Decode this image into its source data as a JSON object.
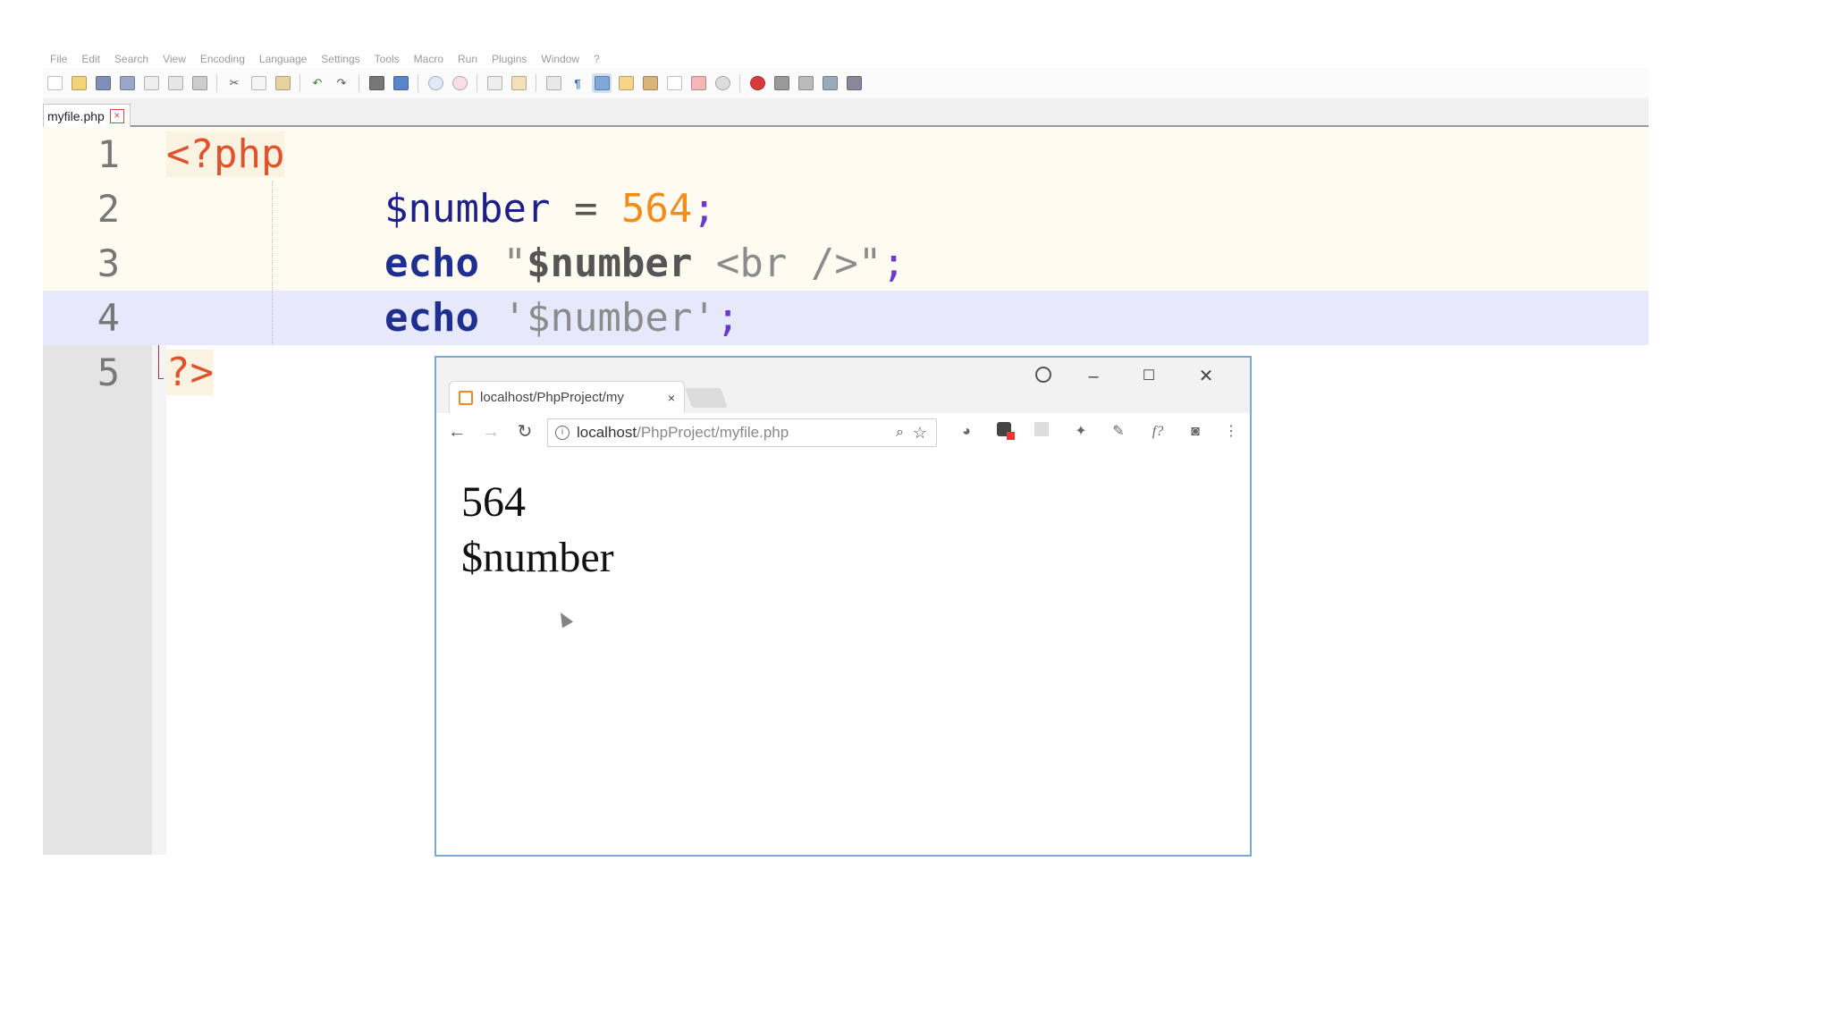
{
  "editor": {
    "menu_items": [
      "File",
      "Edit",
      "Search",
      "View",
      "Encoding",
      "Language",
      "Settings",
      "Tools",
      "Macro",
      "Run",
      "Plugins",
      "Window",
      "?"
    ],
    "tab": {
      "label": "myfile.php",
      "close": "×"
    },
    "lines": [
      {
        "number": "1",
        "php_open": "<?php"
      },
      {
        "number": "2",
        "var": "$number",
        "op": "=",
        "value": "564",
        "semi": ";"
      },
      {
        "number": "3",
        "keyword": "echo",
        "str_open": "\"",
        "str_var": "$number",
        "str_rest": " <br />\"",
        "semi": ";"
      },
      {
        "number": "4",
        "keyword": "echo",
        "str": "'$number'",
        "semi": ";"
      },
      {
        "number": "5",
        "php_close": "?>"
      }
    ]
  },
  "browser": {
    "tab_title": "localhost/PhpProject/my",
    "tab_close": "×",
    "window_controls": {
      "minimize": "–",
      "maximize": "☐",
      "close": "✕"
    },
    "nav": {
      "back": "←",
      "forward": "→",
      "reload": "↻"
    },
    "url_host": "localhost",
    "url_path": "/PhpProject/myfile.php",
    "output": [
      "564",
      "$number"
    ]
  }
}
